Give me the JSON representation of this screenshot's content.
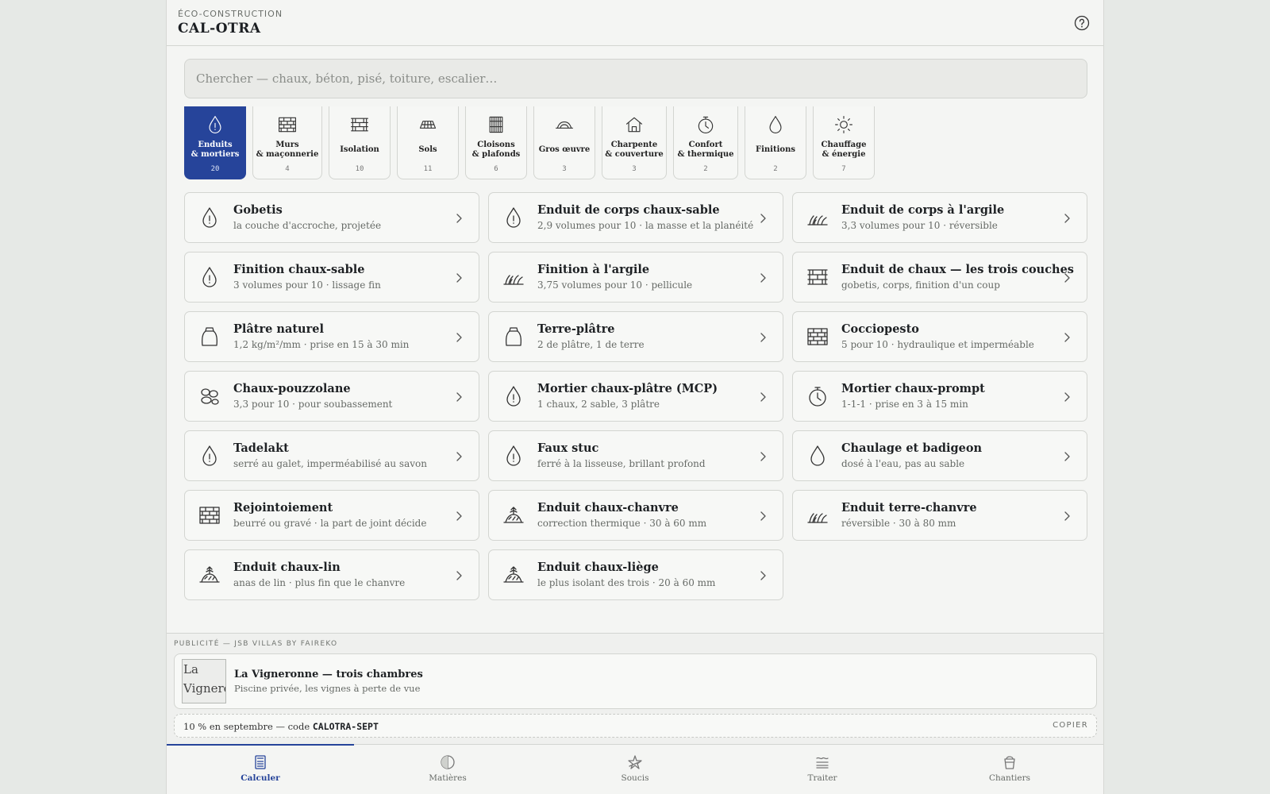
{
  "header": {
    "eyebrow": "ÉCO-CONSTRUCTION",
    "brand": "CAL-OTRA",
    "help_icon": "help-circle-icon"
  },
  "search": {
    "placeholder": "Chercher — chaux, béton, pisé, toiture, escalier…"
  },
  "categories": [
    {
      "label": "Enduits\n& mortiers",
      "count": "20",
      "icon": "drop-grain-icon",
      "active": true
    },
    {
      "label": "Murs\n& maçonnerie",
      "count": "4",
      "icon": "brick-wall-icon"
    },
    {
      "label": "Isolation",
      "count": "10",
      "icon": "layers-wall-icon"
    },
    {
      "label": "Sols",
      "count": "11",
      "icon": "floor-tiles-icon"
    },
    {
      "label": "Cloisons\n& plafonds",
      "count": "6",
      "icon": "partition-icon"
    },
    {
      "label": "Gros œuvre",
      "count": "3",
      "icon": "arch-icon"
    },
    {
      "label": "Charpente\n& couverture",
      "count": "3",
      "icon": "house-icon"
    },
    {
      "label": "Confort\n& thermique",
      "count": "2",
      "icon": "timer-icon"
    },
    {
      "label": "Finitions",
      "count": "2",
      "icon": "drop-icon"
    },
    {
      "label": "Chauffage\n& énergie",
      "count": "7",
      "icon": "sun-icon"
    }
  ],
  "recipes": [
    {
      "title": "Gobetis",
      "subtitle": "la couche d'accroche, projetée",
      "icon": "drop-grain-icon"
    },
    {
      "title": "Enduit de corps chaux-sable",
      "subtitle": "2,9 volumes pour 10 · la masse et la planéité",
      "icon": "drop-grain-icon"
    },
    {
      "title": "Enduit de corps à l'argile",
      "subtitle": "3,3 volumes pour 10 · réversible",
      "icon": "straw-icon"
    },
    {
      "title": "Finition chaux-sable",
      "subtitle": "3 volumes pour 10 · lissage fin",
      "icon": "drop-grain-icon"
    },
    {
      "title": "Finition à l'argile",
      "subtitle": "3,75 volumes pour 10 · pellicule",
      "icon": "straw-icon"
    },
    {
      "title": "Enduit de chaux — les trois couches",
      "subtitle": "gobetis, corps, finition d'un coup",
      "icon": "layers-wall-icon"
    },
    {
      "title": "Plâtre naturel",
      "subtitle": "1,2 kg/m²/mm · prise en 15 à 30 min",
      "icon": "sack-icon"
    },
    {
      "title": "Terre-plâtre",
      "subtitle": "2 de plâtre, 1 de terre",
      "icon": "sack-icon"
    },
    {
      "title": "Cocciopesto",
      "subtitle": "5 pour 10 · hydraulique et imperméable",
      "icon": "brick-wall-icon"
    },
    {
      "title": "Chaux-pouzzolane",
      "subtitle": "3,3 pour 10 · pour soubassement",
      "icon": "pebbles-icon"
    },
    {
      "title": "Mortier chaux-plâtre (MCP)",
      "subtitle": "1 chaux, 2 sable, 3 plâtre",
      "icon": "drop-grain-icon"
    },
    {
      "title": "Mortier chaux-prompt",
      "subtitle": "1-1-1 · prise en 3 à 15 min",
      "icon": "timer-icon"
    },
    {
      "title": "Tadelakt",
      "subtitle": "serré au galet, imperméabilisé au savon",
      "icon": "drop-grain-icon"
    },
    {
      "title": "Faux stuc",
      "subtitle": "ferré à la lisseuse, brillant profond",
      "icon": "drop-grain-icon"
    },
    {
      "title": "Chaulage et badigeon",
      "subtitle": "dosé à l'eau, pas au sable",
      "icon": "drop-icon"
    },
    {
      "title": "Rejointoiement",
      "subtitle": "beurré ou gravé · la part de joint décide",
      "icon": "brick-wall-icon"
    },
    {
      "title": "Enduit chaux-chanvre",
      "subtitle": "correction thermique · 30 à 60 mm",
      "icon": "hemp-mound-icon"
    },
    {
      "title": "Enduit terre-chanvre",
      "subtitle": "réversible · 30 à 80 mm",
      "icon": "straw-icon"
    },
    {
      "title": "Enduit chaux-lin",
      "subtitle": "anas de lin · plus fin que le chanvre",
      "icon": "hemp-mound-icon"
    },
    {
      "title": "Enduit chaux-liège",
      "subtitle": "le plus isolant des trois · 20 à 60 mm",
      "icon": "hemp-mound-icon"
    }
  ],
  "ad": {
    "label": "PUBLICITÉ — JSB VILLAS BY FAIREKO",
    "image_alt": "La Vignero",
    "title": "La Vigneronne — trois chambres",
    "subtitle": "Piscine privée, les vignes à perte de vue",
    "promo_text": "10 % en septembre — code ",
    "promo_code": "CALOTRA-SEPT",
    "copy_label": "COPIER"
  },
  "tabs": [
    {
      "label": "Calculer",
      "icon": "calculator-icon",
      "active": true
    },
    {
      "label": "Matières",
      "icon": "half-circle-icon"
    },
    {
      "label": "Soucis",
      "icon": "alert-star-icon"
    },
    {
      "label": "Traiter",
      "icon": "waves-icon"
    },
    {
      "label": "Chantiers",
      "icon": "bucket-icon"
    }
  ],
  "colors": {
    "accent": "#26449a",
    "background": "#f4f5f3",
    "border": "#d3d5d1"
  }
}
